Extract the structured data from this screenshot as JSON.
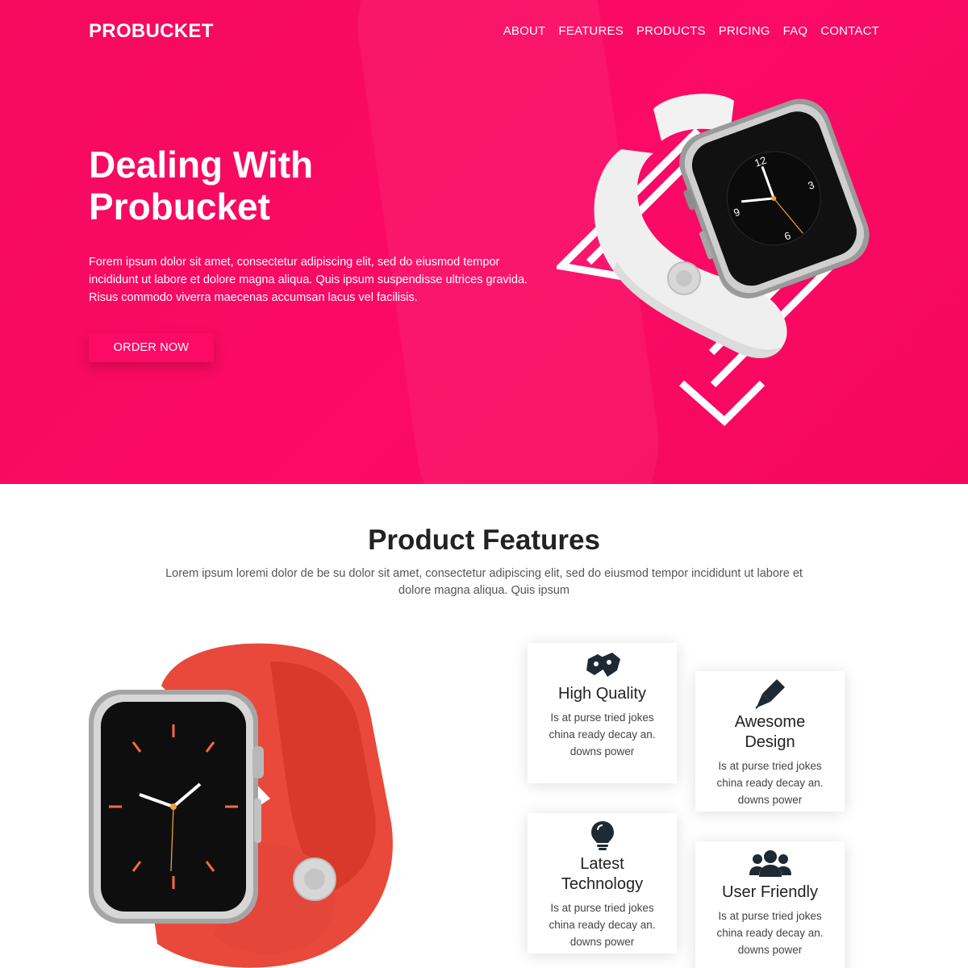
{
  "header": {
    "logo": "PROBUCKET",
    "nav": [
      "ABOUT",
      "FEATURES",
      "PRODUCTS",
      "PRICING",
      "FAQ",
      "CONTACT"
    ]
  },
  "hero": {
    "title_line1": "Dealing With",
    "title_line2": "Probucket",
    "text": "Forem ipsum dolor sit amet, consectetur adipiscing elit, sed do eiusmod tempor incididunt ut labore et dolore magna aliqua. Quis ipsum suspendisse ultrices gravida. Risus commodo viverra maecenas accumsan lacus vel facilisis.",
    "cta": "ORDER NOW",
    "watch_numerals": [
      "12",
      "3",
      "6",
      "9"
    ]
  },
  "features": {
    "title": "Product Features",
    "subtitle": "Lorem ipsum loremi dolor de be su dolor sit amet, consectetur adipiscing elit, sed do eiusmod tempor incididunt ut labore et dolore magna aliqua. Quis ipsum",
    "cards": [
      {
        "icon": "sign-language-icon",
        "title": "High Quality",
        "text": "Is at purse tried jokes china ready decay an. downs power"
      },
      {
        "icon": "pen-nib-icon",
        "title": "Awesome Design",
        "text": "Is at purse tried jokes china ready decay an. downs power"
      },
      {
        "icon": "lightbulb-icon",
        "title": "Latest Technology",
        "text": "Is at purse tried jokes china ready decay an. downs power"
      },
      {
        "icon": "users-icon",
        "title": "User Friendly",
        "text": "Is at purse tried jokes china ready decay an. downs power"
      }
    ]
  },
  "colors": {
    "brand": "#fb0a66",
    "text": "#222222"
  }
}
